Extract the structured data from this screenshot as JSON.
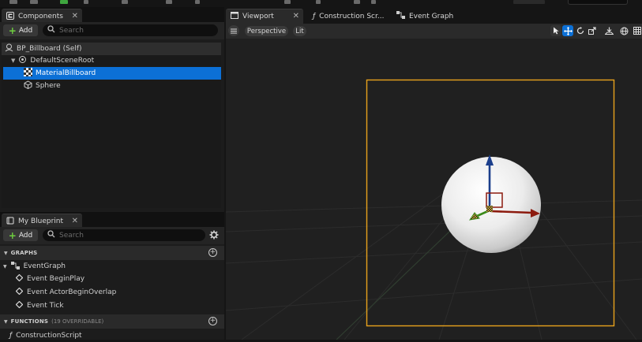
{
  "components_panel": {
    "tab_title": "Components",
    "add_label": "Add",
    "search_placeholder": "Search",
    "tree": {
      "root": "BP_Billboard (Self)",
      "scene_root": "DefaultSceneRoot",
      "children": [
        "MaterialBillboard",
        "Sphere"
      ]
    }
  },
  "blueprint_panel": {
    "tab_title": "My Blueprint",
    "add_label": "Add",
    "search_placeholder": "Search",
    "graphs_header": "GRAPHS",
    "event_graph": "EventGraph",
    "events": [
      "Event BeginPlay",
      "Event ActorBeginOverlap",
      "Event Tick"
    ],
    "functions_header": "FUNCTIONS",
    "functions_sub": "(19 OVERRIDABLE)",
    "function_items": [
      "ConstructionScript"
    ]
  },
  "editor_tabs": [
    {
      "label": "Viewport",
      "active": true
    },
    {
      "label": "Construction Scr...",
      "active": false
    },
    {
      "label": "Event Graph",
      "active": false
    }
  ],
  "viewport_toolbar": {
    "view_mode": "Perspective",
    "lighting": "Lit"
  },
  "colors": {
    "selection": "#0c70d6",
    "bounds": "#e8a21c",
    "gizmo_x": "#a02010",
    "gizmo_y": "#3a8a1a",
    "gizmo_z": "#1c3f8c"
  }
}
